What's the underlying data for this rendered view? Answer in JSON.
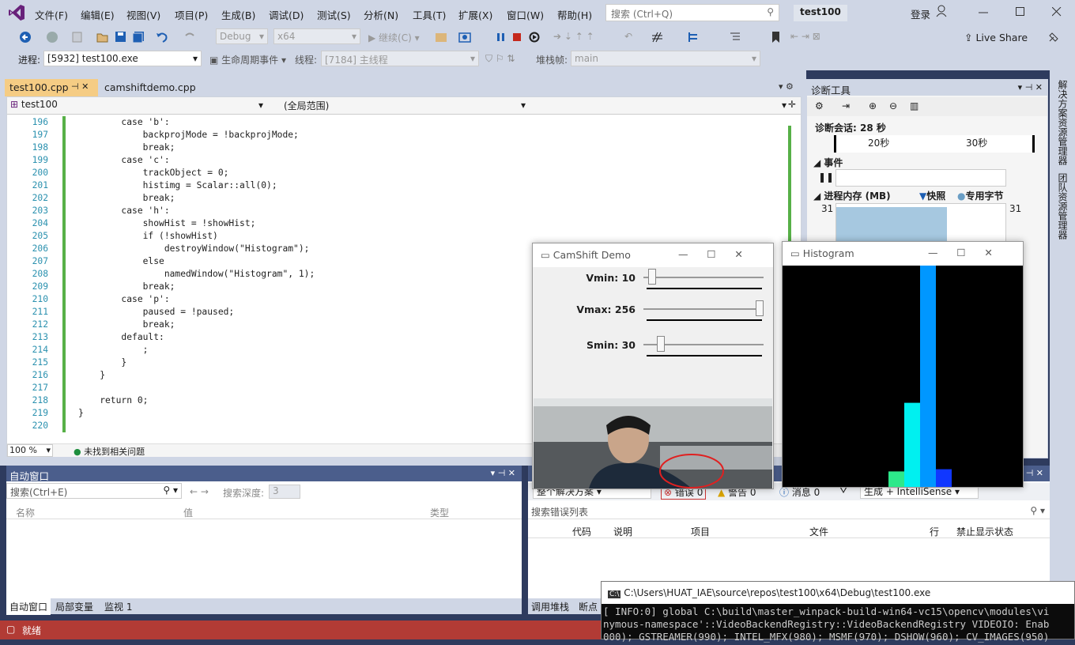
{
  "menu": [
    "文件(F)",
    "编辑(E)",
    "视图(V)",
    "项目(P)",
    "生成(B)",
    "调试(D)",
    "测试(S)",
    "分析(N)",
    "工具(T)",
    "扩展(X)",
    "窗口(W)",
    "帮助(H)"
  ],
  "search_placeholder": "搜索 (Ctrl+Q)",
  "project_badge": "test100",
  "login": "登录",
  "toolbar": {
    "config": "Debug",
    "platform": "x64",
    "continue": "继续(C)",
    "liveshare": "Live Share"
  },
  "toolbar2": {
    "process_label": "进程:",
    "process": "[5932] test100.exe",
    "lifecycle": "生命周期事件",
    "thread_label": "线程:",
    "thread": "[7184] 主线程",
    "stack_label": "堆栈帧:",
    "stack": "main"
  },
  "tabs": [
    {
      "label": "test100.cpp"
    },
    {
      "label": "camshiftdemo.cpp"
    }
  ],
  "nav": {
    "project": "test100",
    "scope": "(全局范围)"
  },
  "code_lines": [
    {
      "n": "196",
      "t": "        case 'b':"
    },
    {
      "n": "197",
      "t": "            backprojMode = !backprojMode;"
    },
    {
      "n": "198",
      "t": "            break;"
    },
    {
      "n": "199",
      "t": "        case 'c':"
    },
    {
      "n": "200",
      "t": "            trackObject = 0;"
    },
    {
      "n": "201",
      "t": "            histimg = Scalar::all(0);"
    },
    {
      "n": "202",
      "t": "            break;"
    },
    {
      "n": "203",
      "t": "        case 'h':"
    },
    {
      "n": "204",
      "t": "            showHist = !showHist;"
    },
    {
      "n": "205",
      "t": "            if (!showHist)"
    },
    {
      "n": "206",
      "t": "                destroyWindow(\"Histogram\");"
    },
    {
      "n": "207",
      "t": "            else"
    },
    {
      "n": "208",
      "t": "                namedWindow(\"Histogram\", 1);"
    },
    {
      "n": "209",
      "t": "            break;"
    },
    {
      "n": "210",
      "t": "        case 'p':"
    },
    {
      "n": "211",
      "t": "            paused = !paused;"
    },
    {
      "n": "212",
      "t": "            break;"
    },
    {
      "n": "213",
      "t": "        default:"
    },
    {
      "n": "214",
      "t": "            ;"
    },
    {
      "n": "215",
      "t": "        }"
    },
    {
      "n": "216",
      "t": "    }"
    },
    {
      "n": "217",
      "t": ""
    },
    {
      "n": "218",
      "t": "    return 0;"
    },
    {
      "n": "219",
      "t": "}"
    },
    {
      "n": "220",
      "t": ""
    }
  ],
  "editor_status": {
    "zoom": "100 %",
    "issues": "未找到相关问题"
  },
  "diag": {
    "title": "诊断工具",
    "session": "诊断会话: 28 秒",
    "t20": "20秒",
    "t30": "30秒",
    "events": "事件",
    "memory": "进程内存 (MB)",
    "snapshot": "快照",
    "private": "专用字节",
    "mem_val": "31",
    "mem_fill": 0.92
  },
  "sidebar_tabs": [
    "解决方案资源管理器",
    "团队资源管理器"
  ],
  "autowin": {
    "title": "自动窗口",
    "search": "搜索(Ctrl+E)",
    "depth_label": "搜索深度:",
    "depth": "3",
    "cols": [
      "名称",
      "值",
      "类型"
    ],
    "tabs": [
      "自动窗口",
      "局部变量",
      "监视 1"
    ]
  },
  "errwin": {
    "scope": "整个解决方案",
    "errors": "错误 0",
    "warnings": "警告 0",
    "messages": "消息 0",
    "build": "生成 + IntelliSense",
    "search": "搜索错误列表",
    "cols": [
      "代码",
      "说明",
      "项目",
      "文件",
      "行",
      "禁止显示状态"
    ],
    "tabs": [
      "调用堆栈",
      "断点"
    ]
  },
  "camshift": {
    "title": "CamShift Demo",
    "sliders": [
      {
        "label": "Vmin: 10",
        "pos": 0.04
      },
      {
        "label": "Vmax: 256",
        "pos": 1.0
      },
      {
        "label": "Smin: 30",
        "pos": 0.12
      }
    ]
  },
  "histogram": {
    "title": "Histogram"
  },
  "chart_data": {
    "type": "bar",
    "values": [
      0.07,
      0.38,
      1.0,
      0.08
    ],
    "colors": [
      "#2de88a",
      "#00f0f0",
      "#0097ff",
      "#1037ff"
    ]
  },
  "console": {
    "title": "C:\\Users\\HUAT_IAE\\source\\repos\\test100\\x64\\Debug\\test100.exe",
    "lines": [
      "[ INFO:0] global C:\\build\\master_winpack-build-win64-vc15\\opencv\\modules\\vi",
      "nymous-namespace'::VideoBackendRegistry::VideoBackendRegistry VIDEOIO: Enab",
      "000); GSTREAMER(990); INTEL_MFX(980); MSMF(970); DSHOW(960); CV_IMAGES(950)"
    ]
  },
  "status": "就绪",
  "colors": {
    "accent": "#68217a",
    "status": "#b23b35",
    "panel": "#4b5e8c"
  }
}
